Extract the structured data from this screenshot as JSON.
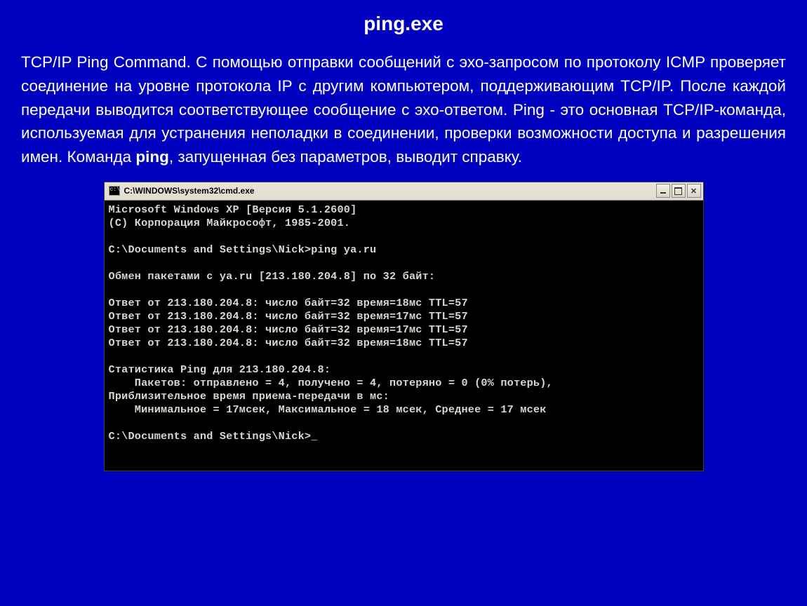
{
  "title": "ping.exe",
  "paragraph": {
    "pre": "TCP/IP Ping Command. С помощью отправки сообщений с эхо-запросом по протоколу ICMP проверяет соединение на уровне протокола IP с другим компьютером, поддерживающим TCP/IP. После каждой передачи выводится соответствующее сообщение с эхо-ответом. Ping - это основная TCP/IP-команда, используемая для устранения неполадки в соединении, проверки возможности доступа и разрешения имен. Команда ",
    "bold": "ping",
    "post": ", запущенная без параметров, выводит справку."
  },
  "cmd": {
    "title": "C:\\WINDOWS\\system32\\cmd.exe",
    "lines": [
      "Microsoft Windows XP [Версия 5.1.2600]",
      "(С) Корпорация Майкрософт, 1985-2001.",
      "",
      "C:\\Documents and Settings\\Nick>ping ya.ru",
      "",
      "Обмен пакетами с ya.ru [213.180.204.8] по 32 байт:",
      "",
      "Ответ от 213.180.204.8: число байт=32 время=18мс TTL=57",
      "Ответ от 213.180.204.8: число байт=32 время=17мс TTL=57",
      "Ответ от 213.180.204.8: число байт=32 время=17мс TTL=57",
      "Ответ от 213.180.204.8: число байт=32 время=18мс TTL=57",
      "",
      "Статистика Ping для 213.180.204.8:",
      "    Пакетов: отправлено = 4, получено = 4, потеряно = 0 (0% потерь),",
      "Приблизительное время приема-передачи в мс:",
      "    Минимальное = 17мсек, Максимальное = 18 мсек, Среднее = 17 мсек",
      "",
      "C:\\Documents and Settings\\Nick>_"
    ]
  }
}
